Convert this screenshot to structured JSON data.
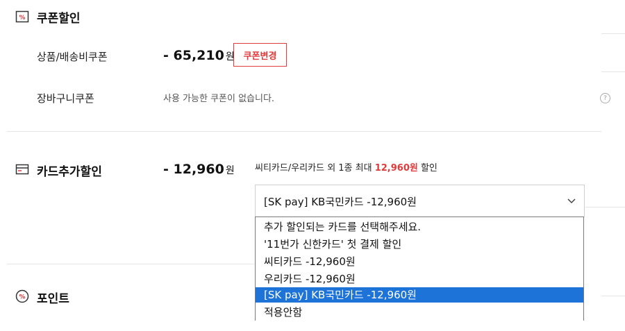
{
  "coupon": {
    "title": "쿠폰할인",
    "icon": "percent-coupon-icon",
    "product_label": "상품/배송비쿠폰",
    "product_amount": "- 65,210",
    "won": "원",
    "change_button": "쿠폰변경",
    "cart_label": "장바구니쿠폰",
    "cart_info": "사용 가능한 쿠폰이 없습니다."
  },
  "card": {
    "title": "카드추가할인",
    "icon": "credit-card-icon",
    "amount": "- 12,960",
    "won": "원",
    "desc_prefix": "씨티카드/우리카드 외 1종 최대 ",
    "desc_highlight": "12,960원",
    "desc_suffix": " 할인",
    "selected": "[SK pay] KB국민카드 -12,960원",
    "options": [
      "추가 할인되는 카드를 선택해주세요.",
      "'11번가 신한카드' 첫 결제 할인",
      "씨티카드 -12,960원",
      "우리카드 -12,960원",
      "[SK pay] KB국민카드 -12,960원",
      "적용안함"
    ],
    "highlighted_option": 4
  },
  "point": {
    "title": "포인트",
    "icon": "percent-circle-icon"
  },
  "colors": {
    "accent": "#e03a3a",
    "highlight": "#1e73d8"
  }
}
